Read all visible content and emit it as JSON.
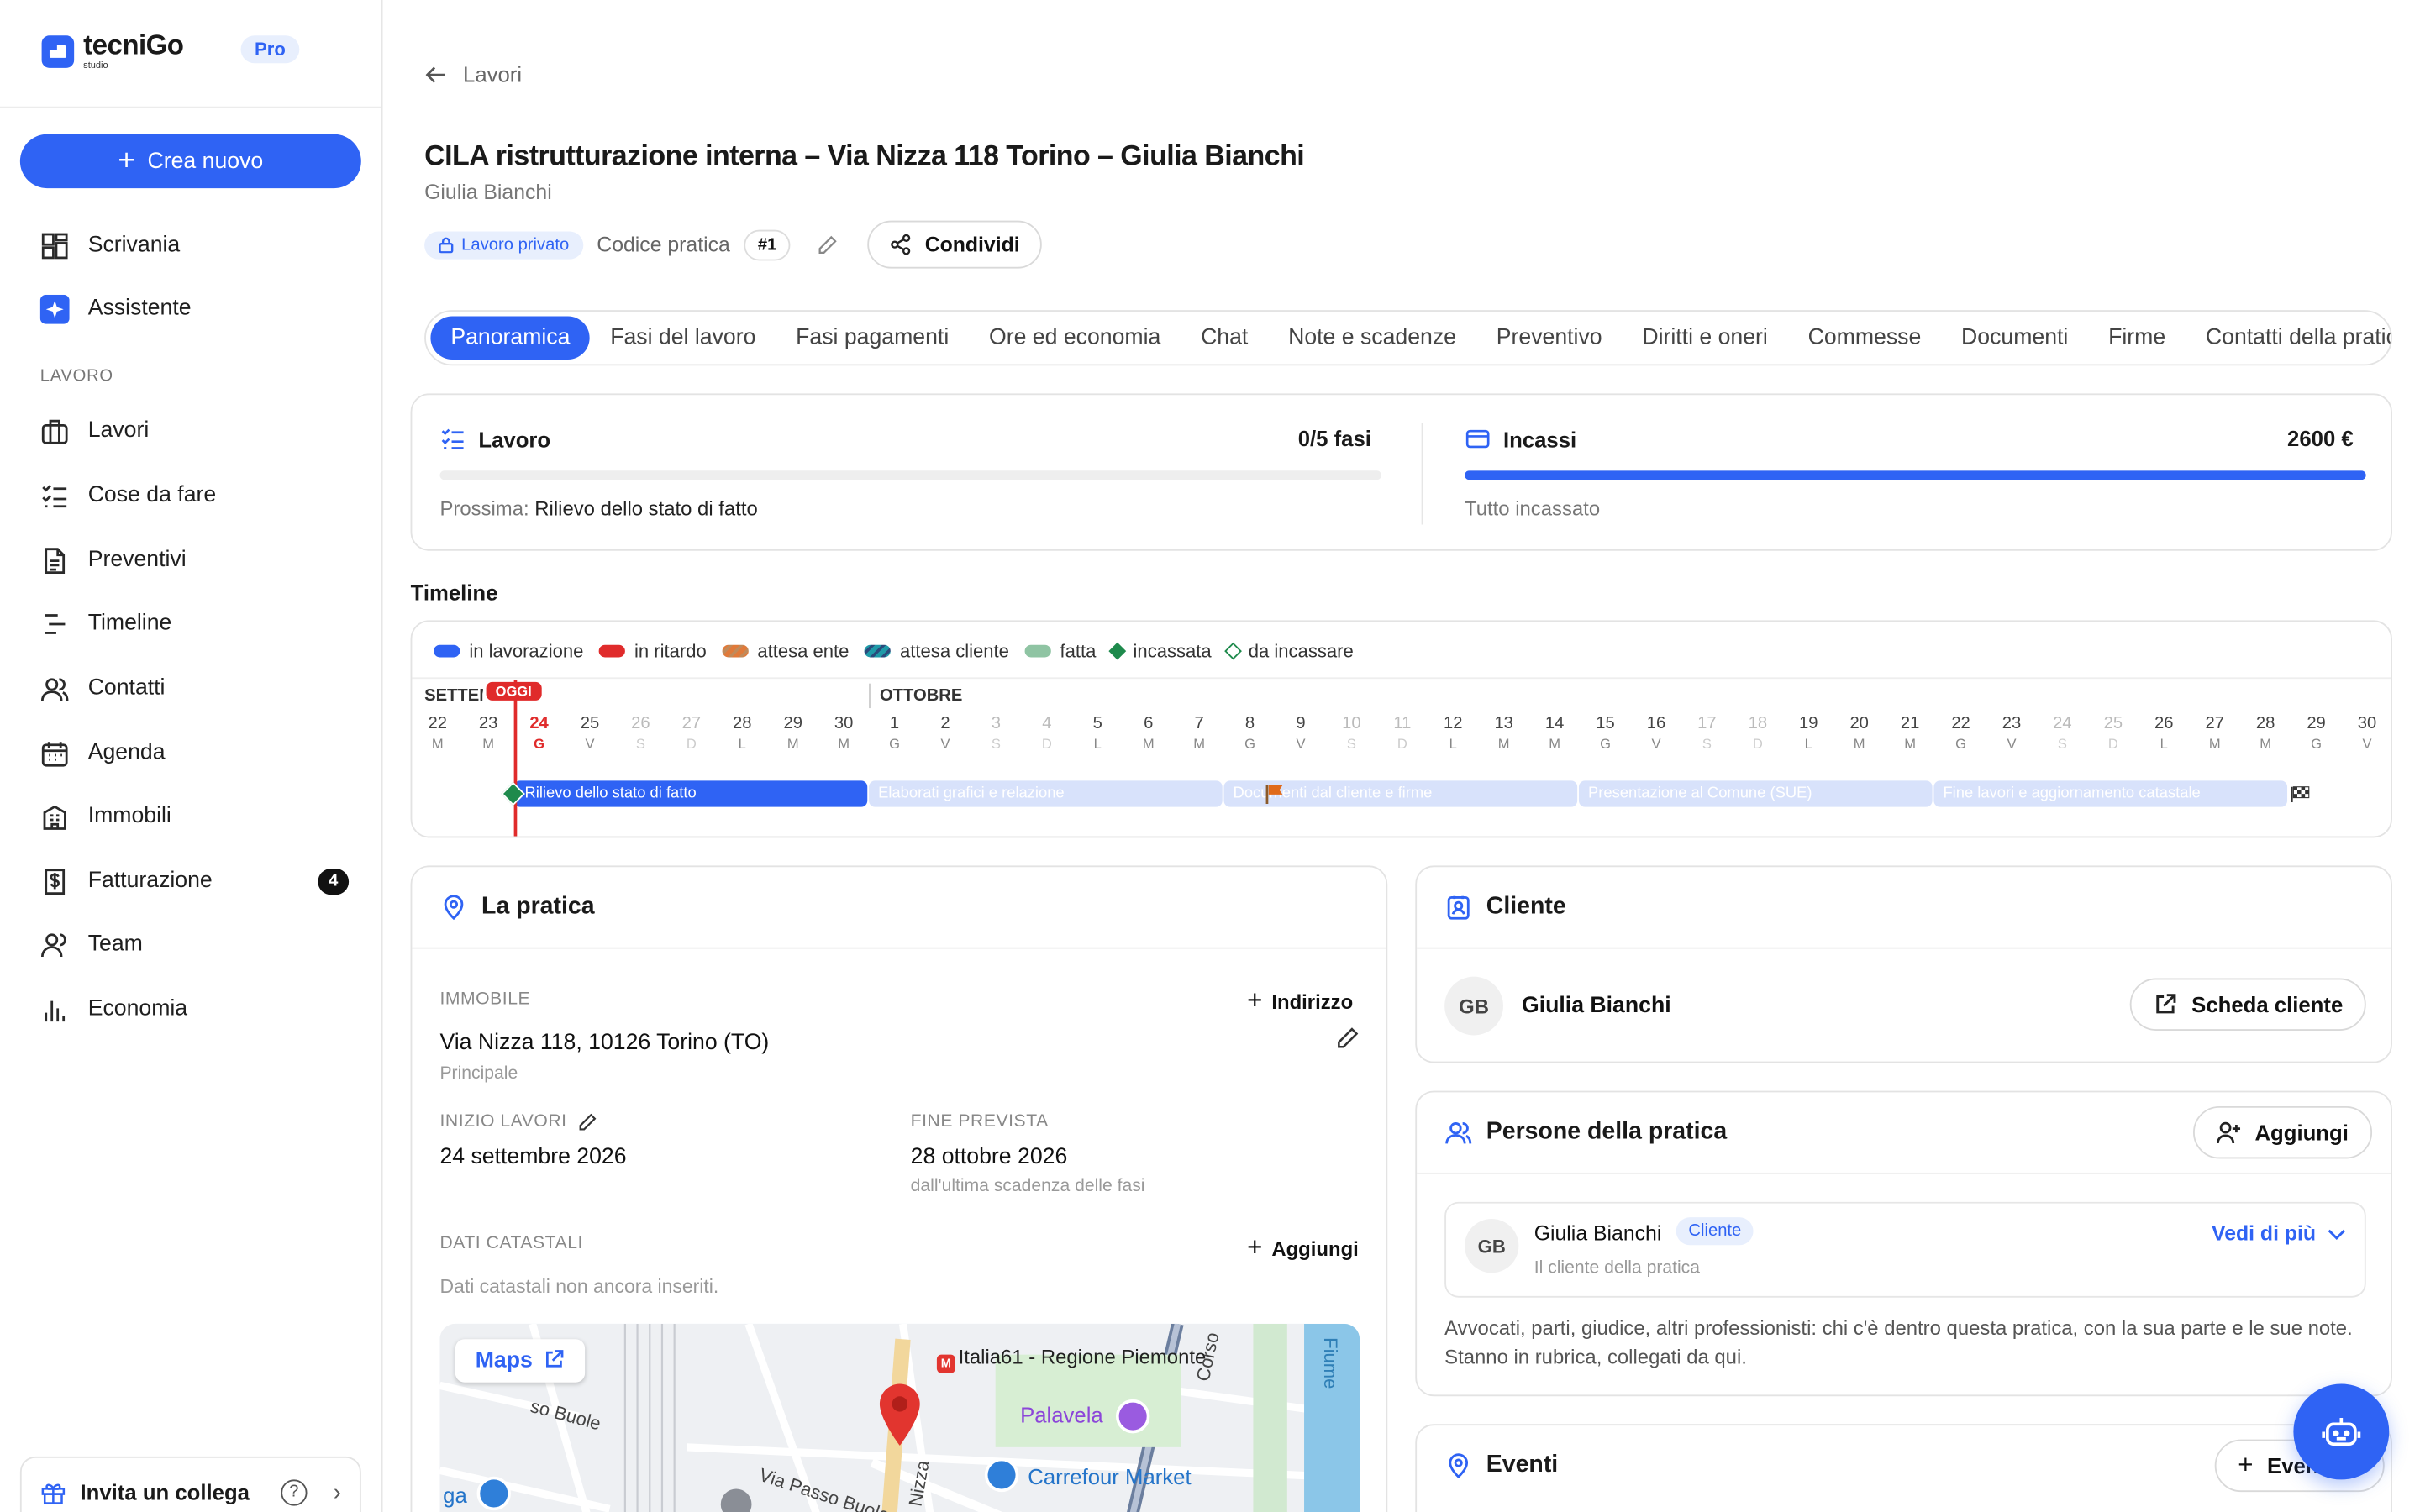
{
  "brand": {
    "name": "tecniGo",
    "sub": "studio",
    "plan": "Pro"
  },
  "sidebar": {
    "create_label": "Crea nuovo",
    "top_items": [
      {
        "label": "Scrivania",
        "icon": "dashboard-icon"
      },
      {
        "label": "Assistente",
        "icon": "sparkle-icon"
      }
    ],
    "section_label": "LAVORO",
    "items": [
      {
        "label": "Lavori",
        "icon": "briefcase-icon"
      },
      {
        "label": "Cose da fare",
        "icon": "checklist-icon"
      },
      {
        "label": "Preventivi",
        "icon": "document-icon"
      },
      {
        "label": "Timeline",
        "icon": "timeline-icon"
      },
      {
        "label": "Contatti",
        "icon": "users-icon"
      },
      {
        "label": "Agenda",
        "icon": "calendar-icon"
      },
      {
        "label": "Immobili",
        "icon": "building-icon"
      },
      {
        "label": "Fatturazione",
        "icon": "invoice-icon",
        "badge": "4"
      },
      {
        "label": "Team",
        "icon": "team-icon"
      },
      {
        "label": "Economia",
        "icon": "chart-icon"
      }
    ],
    "invite_label": "Invita un collega",
    "help_glyph": "?",
    "chevron_glyph": "›"
  },
  "header": {
    "back_label": "Lavori",
    "title": "CILA ristrutturazione interna – Via Nizza 118 Torino – Giulia Bianchi",
    "subtitle": "Giulia Bianchi",
    "private_badge": "Lavoro privato",
    "code_label": "Codice pratica",
    "code_value": "#1",
    "share_label": "Condividi"
  },
  "tabs": [
    "Panoramica",
    "Fasi del lavoro",
    "Fasi pagamenti",
    "Ore ed economia",
    "Chat",
    "Note e scadenze",
    "Preventivo",
    "Diritti e oneri",
    "Commesse",
    "Documenti",
    "Firme",
    "Contatti della pratica"
  ],
  "progress": {
    "work": {
      "label": "Lavoro",
      "value": "0/5 fasi",
      "fraction": 0,
      "next_prefix": "Prossima:",
      "next_value": "Rilievo dello stato di fatto"
    },
    "income": {
      "label": "Incassi",
      "value": "2600 €",
      "fraction": 1,
      "note": "Tutto incassato"
    }
  },
  "timeline": {
    "title": "Timeline",
    "legend": [
      {
        "label": "in lavorazione",
        "color": "#2f63f4",
        "kind": "bar"
      },
      {
        "label": "in ritardo",
        "color": "#e02b2b",
        "kind": "bar"
      },
      {
        "label": "attesa ente",
        "color": "#e07a3a",
        "kind": "striped"
      },
      {
        "label": "attesa cliente",
        "color": "#1f9aa8",
        "kind": "striped"
      },
      {
        "label": "fatta",
        "color": "#8fc4a3",
        "kind": "bar"
      },
      {
        "label": "incassata",
        "color": "#1e8a4c",
        "kind": "diamond"
      },
      {
        "label": "da incassare",
        "color": "#1e8a4c",
        "kind": "diamond-outline"
      }
    ],
    "months": [
      "SETTEMBRE",
      "OTTOBRE"
    ],
    "today_label": "OGGI",
    "days": [
      [
        "22",
        "M"
      ],
      [
        "23",
        "M"
      ],
      [
        "24",
        "G"
      ],
      [
        "25",
        "V"
      ],
      [
        "26",
        "S"
      ],
      [
        "27",
        "D"
      ],
      [
        "28",
        "L"
      ],
      [
        "29",
        "M"
      ],
      [
        "30",
        "M"
      ],
      [
        "1",
        "G"
      ],
      [
        "2",
        "V"
      ],
      [
        "3",
        "S"
      ],
      [
        "4",
        "D"
      ],
      [
        "5",
        "L"
      ],
      [
        "6",
        "M"
      ],
      [
        "7",
        "M"
      ],
      [
        "8",
        "G"
      ],
      [
        "9",
        "V"
      ],
      [
        "10",
        "S"
      ],
      [
        "11",
        "D"
      ],
      [
        "12",
        "L"
      ],
      [
        "13",
        "M"
      ],
      [
        "14",
        "M"
      ],
      [
        "15",
        "G"
      ],
      [
        "16",
        "V"
      ],
      [
        "17",
        "S"
      ],
      [
        "18",
        "D"
      ],
      [
        "19",
        "L"
      ],
      [
        "20",
        "M"
      ],
      [
        "21",
        "M"
      ],
      [
        "22",
        "G"
      ],
      [
        "23",
        "V"
      ],
      [
        "24",
        "S"
      ],
      [
        "25",
        "D"
      ],
      [
        "26",
        "L"
      ],
      [
        "27",
        "M"
      ],
      [
        "28",
        "M"
      ],
      [
        "29",
        "G"
      ],
      [
        "30",
        "V"
      ]
    ],
    "phases": [
      {
        "label": "Rilievo dello stato di fatto",
        "status": "in lavorazione"
      },
      {
        "label": "Elaborati grafici e relazione",
        "status": "planned"
      },
      {
        "label": "Documenti dal cliente e firme",
        "status": "planned"
      },
      {
        "label": "Presentazione al Comune (SUE)",
        "status": "planned"
      },
      {
        "label": "Fine lavori e aggiornamento catastale",
        "status": "planned"
      }
    ]
  },
  "pratica": {
    "title": "La pratica",
    "immobile_label": "IMMOBILE",
    "add_address": "Indirizzo",
    "address": "Via Nizza 118, 10126 Torino (TO)",
    "address_tag": "Principale",
    "start_label": "INIZIO LAVORI",
    "start_value": "24 settembre 2026",
    "end_label": "FINE PREVISTA",
    "end_value": "28 ottobre 2026",
    "end_hint": "dall'ultima scadenza delle fasi",
    "cadastral_label": "DATI CATASTALI",
    "cadastral_add": "Aggiungi",
    "cadastral_empty": "Dati catastali non ancora inseriti.",
    "map": {
      "button": "Maps",
      "places": [
        "Italia61 - Regione Piemonte",
        "Palavela",
        "Carrefour Market",
        "Via Passo Buole",
        "Nizza",
        "Corso",
        "Fiume"
      ],
      "fragments": [
        "so Buole",
        "ga"
      ]
    }
  },
  "cliente": {
    "title": "Cliente",
    "initials": "GB",
    "name": "Giulia Bianchi",
    "button": "Scheda cliente"
  },
  "persone": {
    "title": "Persone della pratica",
    "add_label": "Aggiungi",
    "person": {
      "initials": "GB",
      "name": "Giulia Bianchi",
      "role": "Cliente",
      "desc": "Il cliente della pratica",
      "more": "Vedi di più"
    },
    "description": "Avvocati, parti, giudice, altri professionisti: chi c'è dentro questa pratica, con la sua parte e le sue note. Stanno in rubrica, collegati da qui."
  },
  "eventi": {
    "title": "Eventi",
    "add_label": "Eventi"
  },
  "colors": {
    "accent": "#2f63f4",
    "today": "#e02b2b",
    "done": "#1e8a4c"
  }
}
